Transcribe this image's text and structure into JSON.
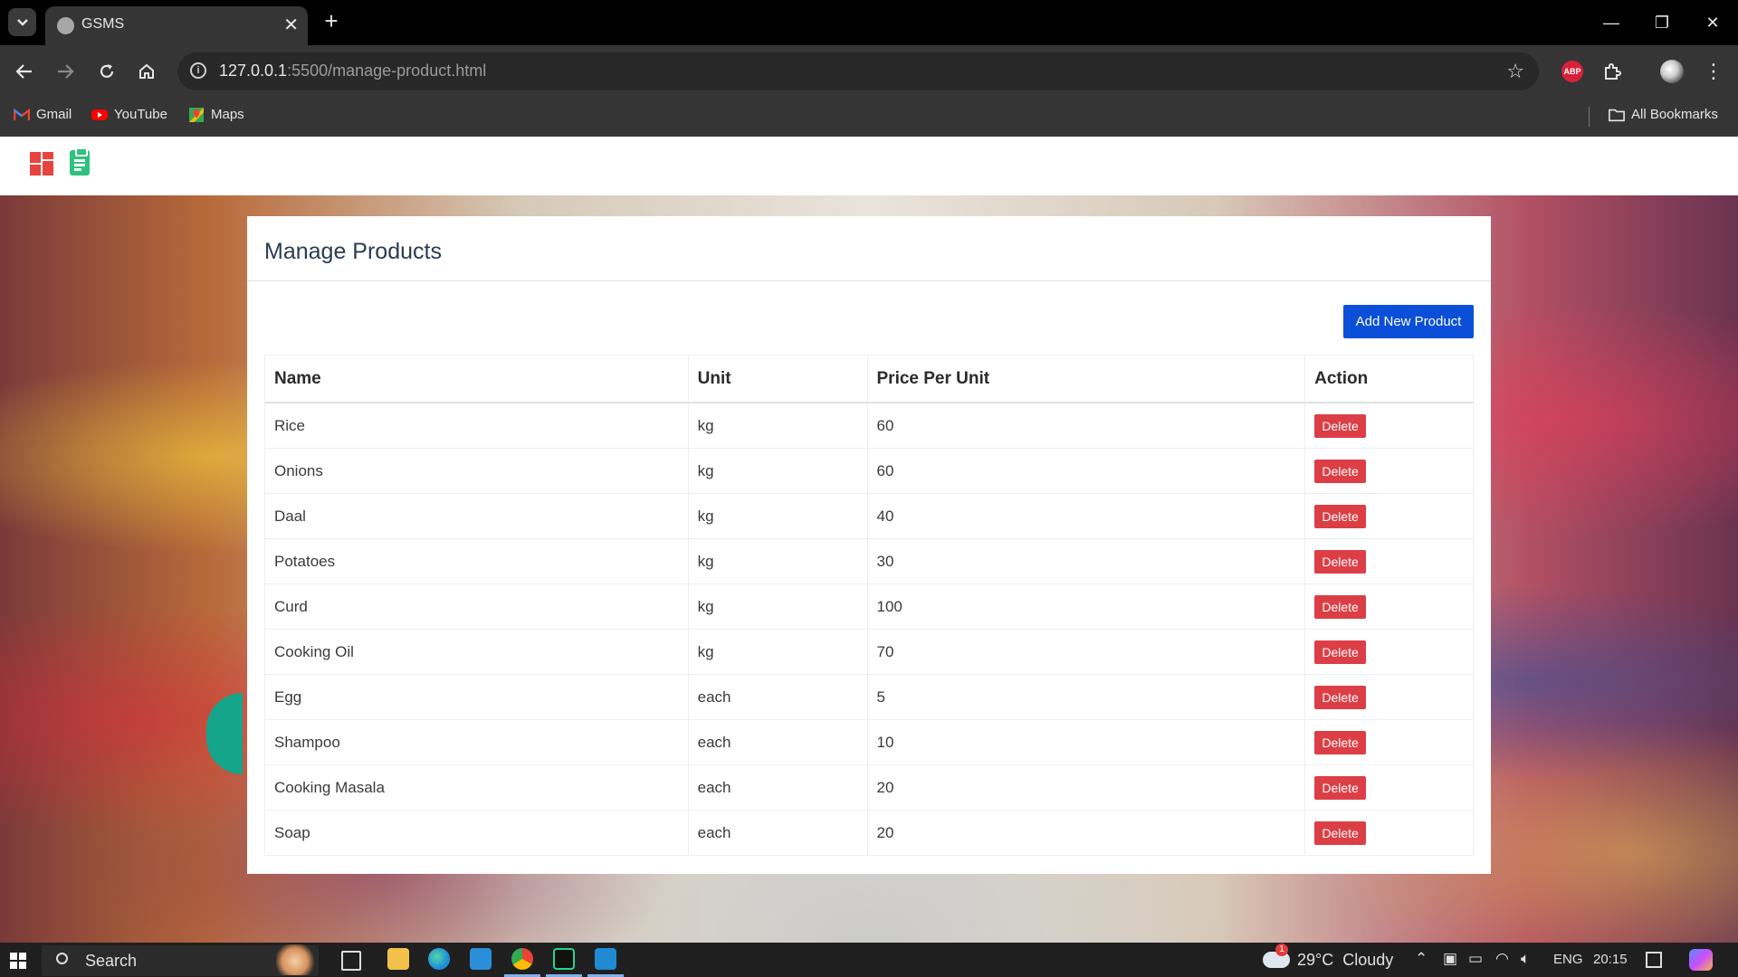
{
  "browser": {
    "tab_title": "GSMS",
    "url_host": "127.0.0.1",
    "url_path": ":5500/manage-product.html",
    "bookmarks": [
      {
        "label": "Gmail",
        "icon": "gmail-icon"
      },
      {
        "label": "YouTube",
        "icon": "youtube-icon"
      },
      {
        "label": "Maps",
        "icon": "maps-icon"
      }
    ],
    "all_bookmarks": "All Bookmarks",
    "abp_label": "ABP"
  },
  "page": {
    "title": "Manage Products",
    "add_button": "Add New Product",
    "table": {
      "headers": [
        "Name",
        "Unit",
        "Price Per Unit",
        "Action"
      ],
      "rows": [
        {
          "name": "Rice",
          "unit": "kg",
          "price": "60",
          "action": "Delete"
        },
        {
          "name": "Onions",
          "unit": "kg",
          "price": "60",
          "action": "Delete"
        },
        {
          "name": "Daal",
          "unit": "kg",
          "price": "40",
          "action": "Delete"
        },
        {
          "name": "Potatoes",
          "unit": "kg",
          "price": "30",
          "action": "Delete"
        },
        {
          "name": "Curd",
          "unit": "kg",
          "price": "100",
          "action": "Delete"
        },
        {
          "name": "Cooking Oil",
          "unit": "kg",
          "price": "70",
          "action": "Delete"
        },
        {
          "name": "Egg",
          "unit": "each",
          "price": "5",
          "action": "Delete"
        },
        {
          "name": "Shampoo",
          "unit": "each",
          "price": "10",
          "action": "Delete"
        },
        {
          "name": "Cooking Masala",
          "unit": "each",
          "price": "20",
          "action": "Delete"
        },
        {
          "name": "Soap",
          "unit": "each",
          "price": "20",
          "action": "Delete"
        }
      ]
    }
  },
  "taskbar": {
    "search_label": "Search",
    "weather": "29°C  Cloudy",
    "weather_badge": "1",
    "language": "ENG",
    "time": "20:15"
  },
  "colors": {
    "primary_button": "#0b4fd9",
    "danger_button": "#dc3e45",
    "logo_red": "#e8433e",
    "logo_green": "#2ec27e"
  }
}
